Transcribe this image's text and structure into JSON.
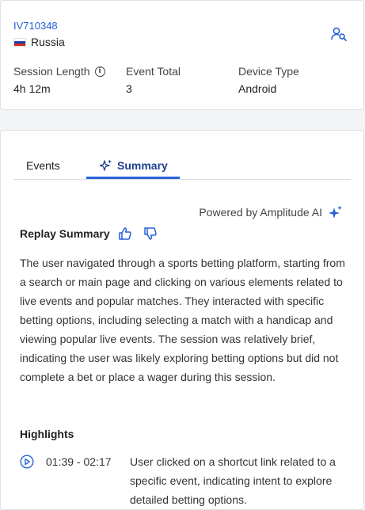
{
  "session": {
    "user_id": "IV710348",
    "country": "Russia",
    "fields": [
      {
        "label": "Session Length",
        "value": "4h 12m"
      },
      {
        "label": "Event Total",
        "value": "3"
      },
      {
        "label": "Device Type",
        "value": "Android"
      }
    ]
  },
  "tabs": [
    {
      "label": "Events"
    },
    {
      "label": "Summary"
    }
  ],
  "summary": {
    "powered_by": "Powered by Amplitude AI",
    "title": "Replay Summary",
    "text": "The user navigated through a sports betting platform, starting from a search or main page and clicking on various elements related to live events and popular matches. They interacted with specific betting options, including selecting a match with a handicap and viewing popular live events. The session was relatively brief, indicating the user was likely exploring betting options but did not complete a bet or place a wager during this session.",
    "highlights_title": "Highlights",
    "highlights": [
      {
        "time": "01:39 - 02:17",
        "text": "User clicked on a shortcut link related to a specific event, indicating intent to explore detailed betting options."
      }
    ]
  },
  "colors": {
    "accent": "#2563d6",
    "active_tab_text": "#1f3f8f"
  },
  "icons": [
    "info-icon",
    "user-search-icon",
    "sparkle-icon",
    "thumbs-up-icon",
    "thumbs-down-icon",
    "play-icon",
    "flag-icon"
  ]
}
